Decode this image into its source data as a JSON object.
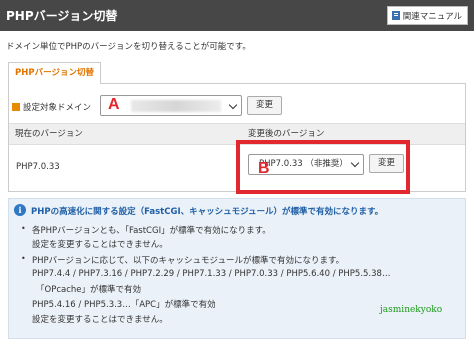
{
  "header": {
    "title": "PHPバージョン切替",
    "manual_label": "関連マニュアル"
  },
  "description": "ドメイン単位でPHPのバージョンを切り替えることが可能です。",
  "tab": {
    "label": "PHPバージョン切替"
  },
  "domain": {
    "label": "設定対象ドメイン",
    "change_label": "変更"
  },
  "table": {
    "current_header": "現在のバージョン",
    "after_header": "変更後のバージョン",
    "current_value": "PHP7.0.33",
    "selected_version": "PHP7.0.33 （非推奨）",
    "change_label": "変更"
  },
  "annotations": {
    "a": "A",
    "b": "B"
  },
  "info": {
    "title": "PHPの高速化に関する設定（FastCGI、キャッシュモジュール）が標準で有効になります。",
    "b1_line1": "各PHPバージョンとも、「FastCGI」が標準で有効になります。",
    "b1_line2": "設定を変更することはできません。",
    "b2_line1": "PHPバージョンに応じて、以下のキャッシュモジュールが標準で有効になります。",
    "b2_line2": "PHP7.4.4 / PHP7.3.16 / PHP7.2.29 / PHP7.1.33 / PHP7.0.33 / PHP5.6.40 / PHP5.5.38…",
    "b2_line3": "「OPcache」が標準で有効",
    "b2_line4": "PHP5.4.16 / PHP5.3.3…「APC」が標準で有効",
    "b2_line5": "設定を変更することはできません。"
  },
  "watermark": "jasminekyoko"
}
